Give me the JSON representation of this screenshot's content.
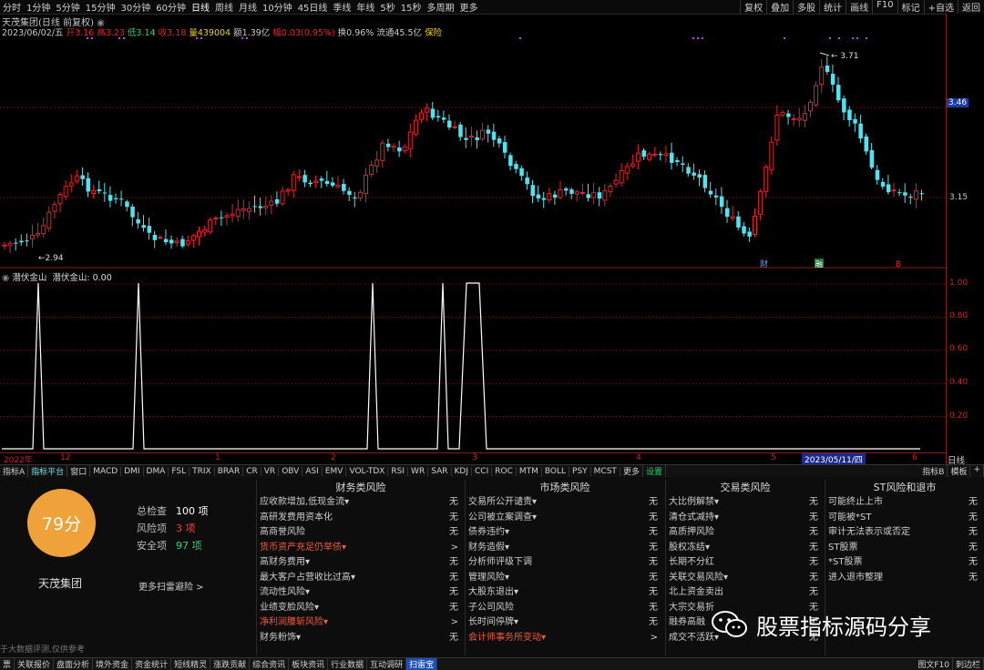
{
  "toolbar": {
    "periods": [
      "分时",
      "1分钟",
      "5分钟",
      "15分钟",
      "30分钟",
      "60分钟",
      "日线",
      "周线",
      "月线",
      "10分钟",
      "45日线",
      "季线",
      "年线",
      "5秒",
      "15秒",
      "多周期",
      "更多"
    ],
    "active_period": "日线",
    "right_buttons": [
      "复权",
      "叠加",
      "多股",
      "统计",
      "画线",
      "F10",
      "标记",
      "+自选",
      "返回"
    ]
  },
  "kchart": {
    "title": "天茂集团(日线 前复权)",
    "date_label": "2023/06/02/五",
    "open": {
      "label": "开",
      "value": "3.16"
    },
    "high": {
      "label": "高",
      "value": "3.23"
    },
    "low": {
      "label": "低",
      "value": "3.14"
    },
    "close": {
      "label": "收",
      "value": "3.18"
    },
    "volume": {
      "label": "量",
      "value": "439004"
    },
    "amount": {
      "label": "额",
      "value": "1.39亿"
    },
    "change": {
      "label": "幅",
      "value": "0.03(0.95%)"
    },
    "turnover": {
      "label": "换",
      "value": "0.96%"
    },
    "float": {
      "label": "流通",
      "value": "45.5亿"
    },
    "insurance": "保险",
    "max_label": "3.71",
    "min_label": "2.94",
    "price_current": "3.46",
    "price_ref": "3.15",
    "markers": [
      "财",
      "融",
      "B"
    ],
    "colors": {
      "up": "#e8202a",
      "down": "#4fe3f0",
      "bg": "#000000"
    }
  },
  "indicator": {
    "title": "潜伏金山",
    "value_text": "潜伏金山: 0.00",
    "axis": [
      "1.00",
      "0.80",
      "0.60",
      "0.40",
      "0.20"
    ],
    "bottom_label": "日线"
  },
  "dates": {
    "ticks": [
      "2022年",
      "12",
      "1",
      "2",
      "3",
      "4",
      "5",
      "6"
    ],
    "selected": "2023/05/11/四"
  },
  "indicator_tabs": {
    "items": [
      "指标A",
      "指标平台",
      "窗口",
      "MACD",
      "DMI",
      "DMA",
      "FSL",
      "TRIX",
      "BRAR",
      "CR",
      "VR",
      "OBV",
      "ASI",
      "EMV",
      "VOL-TDX",
      "RSI",
      "WR",
      "SAR",
      "KDJ",
      "CCI",
      "ROC",
      "MTM",
      "BOLL",
      "PSY",
      "MCST",
      "更多",
      "设置"
    ],
    "right": [
      "指标B",
      "模板",
      "+"
    ]
  },
  "risk": {
    "score": "79分",
    "company": "天茂集团",
    "stats": [
      {
        "label": "总检查",
        "value": "100 项"
      },
      {
        "label": "风险项",
        "value": "3 项"
      },
      {
        "label": "安全项",
        "value": "97 项"
      }
    ],
    "more": "更多扫雷避险 >",
    "disclaimer": "于大数据评测,仅供参考",
    "columns": [
      {
        "title": "财务类风险",
        "rows": [
          {
            "label": "应收款增加,低现金流▾",
            "v": "无"
          },
          {
            "label": "高研发费用资本化",
            "v": "无"
          },
          {
            "label": "高商誉风险",
            "v": "无"
          },
          {
            "label": "货币资产充足仍举债▾",
            "v": ">",
            "hl": true
          },
          {
            "label": "高财务费用▾",
            "v": "无"
          },
          {
            "label": "最大客户占营收比过高▾",
            "v": "无"
          },
          {
            "label": "流动性风险▾",
            "v": "无"
          },
          {
            "label": "业绩变脸风险▾",
            "v": "无"
          },
          {
            "label": "净利润腰斩风险▾",
            "v": ">",
            "hl": true
          },
          {
            "label": "财务粉饰▾",
            "v": "无"
          }
        ]
      },
      {
        "title": "市场类风险",
        "rows": [
          {
            "label": "交易所公开谴责▾",
            "v": "无"
          },
          {
            "label": "公司被立案调查▾",
            "v": "无"
          },
          {
            "label": "债券违约▾",
            "v": "无"
          },
          {
            "label": "财务造假▾",
            "v": "无"
          },
          {
            "label": "分析师评级下调",
            "v": "无"
          },
          {
            "label": "管理风险▾",
            "v": "无"
          },
          {
            "label": "大股东退出▾",
            "v": "无"
          },
          {
            "label": "子公司风险",
            "v": "无"
          },
          {
            "label": "长时间停牌▾",
            "v": "无"
          },
          {
            "label": "会计师事务所变动▾",
            "v": ">",
            "hl": true
          }
        ]
      },
      {
        "title": "交易类风险",
        "rows": [
          {
            "label": "大比例解禁▾",
            "v": "无"
          },
          {
            "label": "清仓式减持▾",
            "v": "无"
          },
          {
            "label": "高质押风险",
            "v": "无"
          },
          {
            "label": "股权冻结▾",
            "v": "无"
          },
          {
            "label": "长期不分红",
            "v": "无"
          },
          {
            "label": "关联交易风险▾",
            "v": "无"
          },
          {
            "label": "北上资金卖出",
            "v": "无"
          },
          {
            "label": "大宗交易折",
            "v": "无"
          },
          {
            "label": "融券高融",
            "v": "无"
          },
          {
            "label": "成交不活跃▾",
            "v": "无"
          }
        ]
      },
      {
        "title": "ST风险和退市",
        "rows": [
          {
            "label": "可能终止上市",
            "v": "无"
          },
          {
            "label": "可能被*ST",
            "v": "无"
          },
          {
            "label": "审计无法表示或否定",
            "v": "无"
          },
          {
            "label": "ST股票",
            "v": "无"
          },
          {
            "label": "*ST股票",
            "v": "无"
          },
          {
            "label": "进入退市整理",
            "v": "无"
          }
        ]
      }
    ]
  },
  "watermark": "股票指标源码分享",
  "bottom": {
    "items": [
      "票",
      "关联报价",
      "盘面分析",
      "境外资金",
      "资金统计",
      "短线精灵",
      "涨跌贡献",
      "综合资讯",
      "板块资讯",
      "行业数据",
      "互动调研",
      "扫雷宝"
    ],
    "active": "扫雷宝",
    "right": [
      "图文F10",
      "刺边栏"
    ]
  }
}
